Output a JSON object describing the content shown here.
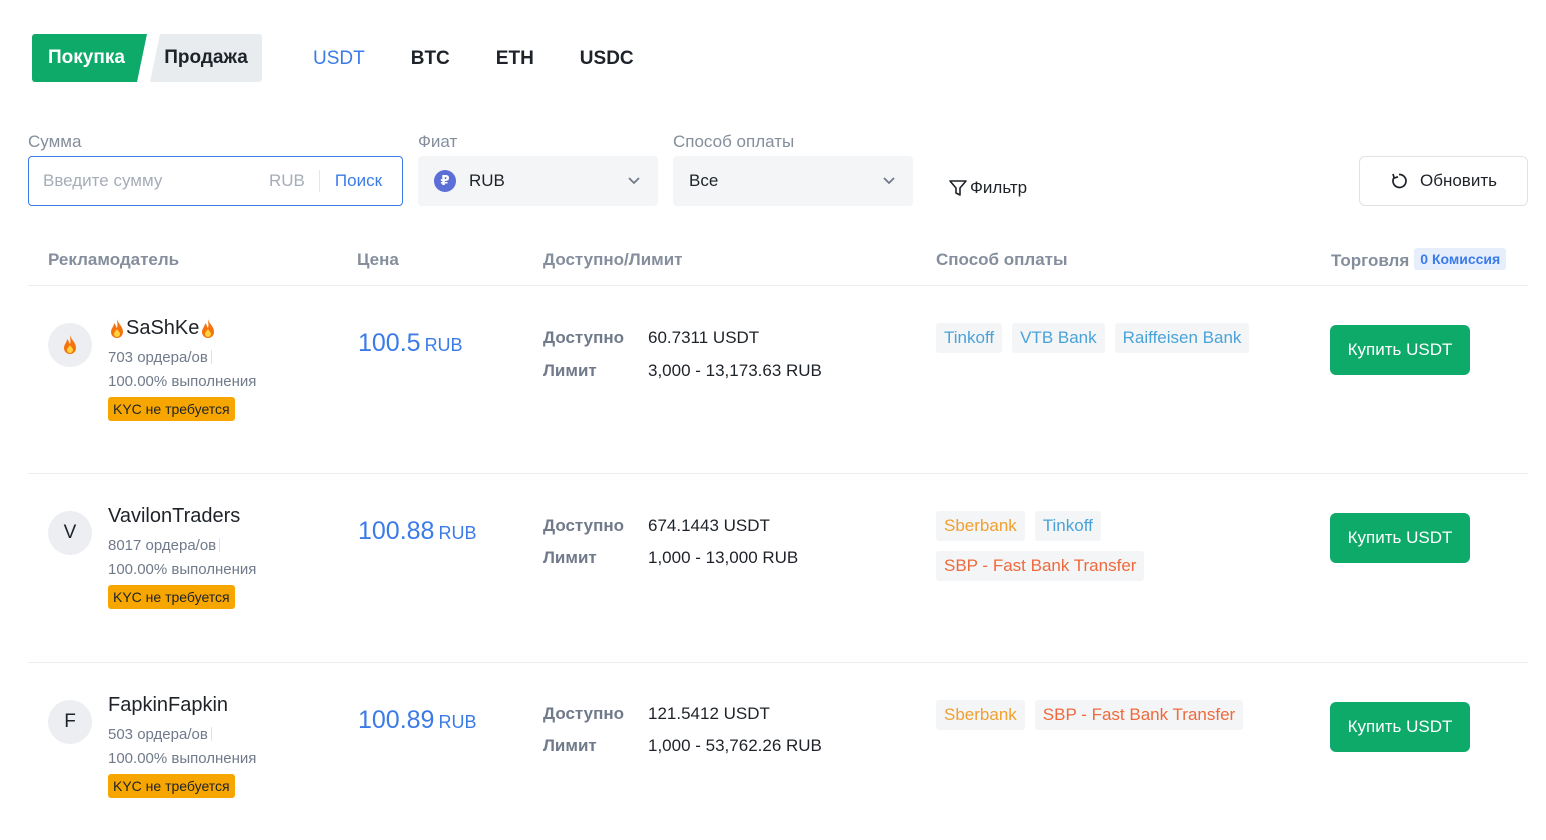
{
  "side_tabs": {
    "buy": "Покупка",
    "sell": "Продажа"
  },
  "coins": [
    "USDT",
    "BTC",
    "ETH",
    "USDC"
  ],
  "filters": {
    "amount_label": "Сумма",
    "amount_placeholder": "Введите сумму",
    "amount_currency": "RUB",
    "search_label": "Поиск",
    "fiat_label": "Фиат",
    "fiat_value": "RUB",
    "fiat_symbol": "₽",
    "payment_label": "Способ оплаты",
    "payment_value": "Все",
    "filter_label": "Фильтр",
    "refresh_label": "Обновить"
  },
  "table_header": {
    "advertiser": "Рекламодатель",
    "price": "Цена",
    "available": "Доступно/Лимит",
    "payment": "Способ оплаты",
    "trade": "Торговля",
    "fee_badge": "0 Комиссия"
  },
  "rows": [
    {
      "avatar": "",
      "name": "SaShKe",
      "orders": "703 ордера/ов",
      "completion": "100.00% выполнения",
      "kyc": "KYC не требуется",
      "price": "100.5",
      "price_currency": "RUB",
      "available_label": "Доступно",
      "available": "60.7311 USDT",
      "limit_label": "Лимит",
      "limit": "3,000 - 13,173.63 RUB",
      "payments": [
        {
          "name": "Tinkoff",
          "color": "#4aa3d8"
        },
        {
          "name": "VTB Bank",
          "color": "#4aa3d8"
        },
        {
          "name": "Raiffeisen Bank",
          "color": "#4aa3d8"
        }
      ],
      "button": "Купить USDT"
    },
    {
      "avatar": "V",
      "name": "VavilonTraders",
      "orders": "8017 ордера/ов",
      "completion": "100.00% выполнения",
      "kyc": "KYC не требуется",
      "price": "100.88",
      "price_currency": "RUB",
      "available_label": "Доступно",
      "available": "674.1443 USDT",
      "limit_label": "Лимит",
      "limit": "1,000 - 13,000 RUB",
      "payments": [
        {
          "name": "Sberbank",
          "color": "#f0a030"
        },
        {
          "name": "Tinkoff",
          "color": "#4aa3d8"
        },
        {
          "name": "SBP - Fast Bank Transfer",
          "color": "#ee6a3c"
        }
      ],
      "button": "Купить USDT"
    },
    {
      "avatar": "F",
      "name": "FapkinFapkin",
      "orders": "503 ордера/ов",
      "completion": "100.00% выполнения",
      "kyc": "KYC не требуется",
      "price": "100.89",
      "price_currency": "RUB",
      "available_label": "Доступно",
      "available": "121.5412 USDT",
      "limit_label": "Лимит",
      "limit": "1,000 - 53,762.26 RUB",
      "payments": [
        {
          "name": "Sberbank",
          "color": "#f0a030"
        },
        {
          "name": "SBP - Fast Bank Transfer",
          "color": "#ee6a3c"
        }
      ],
      "button": "Купить USDT"
    }
  ],
  "colors": {
    "accent_green": "#0eaa6a",
    "accent_blue": "#3b7be8",
    "kyc_badge": "#f7a600"
  }
}
